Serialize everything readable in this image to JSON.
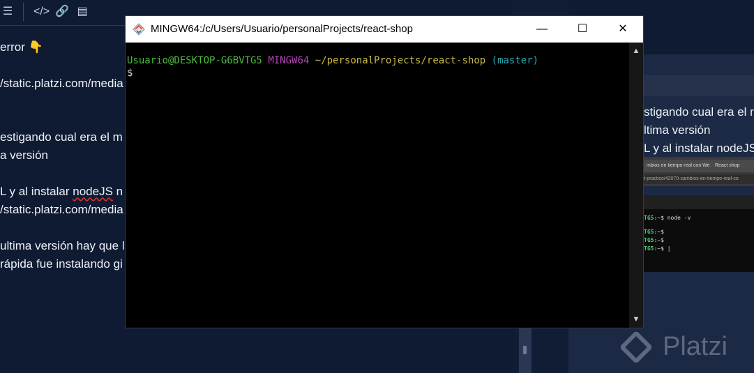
{
  "editor": {
    "lines": [
      "error",
      "/static.platzi.com/media",
      "estigando cual era el m",
      "a versión",
      "L y al instalar ",
      "nodeJS",
      " n",
      "/static.platzi.com/media",
      "ultima versión hay que l",
      "rápida fue instalando gi"
    ],
    "pointer_emoji": "👇"
  },
  "preview": {
    "lines": [
      "stigando cual era el m",
      "ltima versión",
      "L y al instalar nodeJS"
    ],
    "browser_tabs": [
      "mbios en tiempo real con We",
      "React shop"
    ],
    "browser_url": "t-practico/42070-cambios-en-tiempo-real-co",
    "term_rows": [
      {
        "prompt": "TG5:",
        "rest": "~$ node -v"
      },
      {
        "prompt": "TG5:",
        "rest": "~$"
      },
      {
        "prompt": "TG5:",
        "rest": "~$"
      },
      {
        "prompt": "TG5:",
        "rest": "~$ |"
      }
    ],
    "watermark": "Platzi"
  },
  "terminal": {
    "title": "MINGW64:/c/Users/Usuario/personalProjects/react-shop",
    "prompt_user": "Usuario@DESKTOP-G6BVTG5",
    "prompt_env": "MINGW64",
    "prompt_path": "~/personalProjects/react-shop",
    "prompt_branch": "(master)",
    "input_line": "$"
  },
  "window_controls": {
    "minimize": "—",
    "maximize": "☐",
    "close": "✕"
  }
}
